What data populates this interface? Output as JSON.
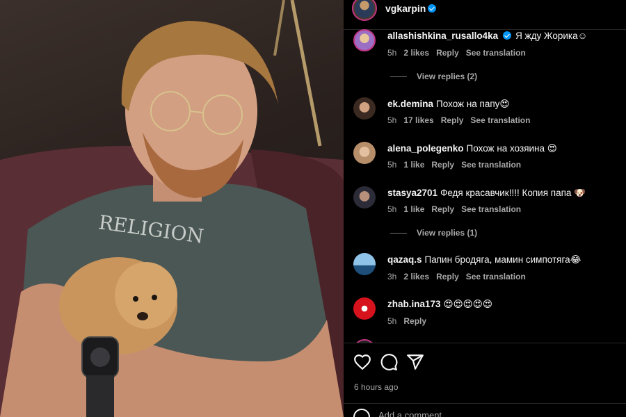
{
  "post": {
    "author": "vgkarpin",
    "time_ago": "6 hours ago",
    "add_comment_placeholder": "Add a comment..."
  },
  "comments": [
    {
      "username": "allashishkina_rusallo4ka",
      "verified": true,
      "text": "Я жду Жорика☺",
      "time": "5h",
      "likes": "2 likes",
      "reply": "Reply",
      "translate": "See translation",
      "view_replies": "View replies (2)"
    },
    {
      "username": "ek.demina",
      "text": "Похож на папу😍",
      "time": "5h",
      "likes": "17 likes",
      "reply": "Reply",
      "translate": "See translation"
    },
    {
      "username": "alena_polegenko",
      "text": "Похож на хозяина 😍",
      "time": "5h",
      "likes": "1 like",
      "reply": "Reply",
      "translate": "See translation"
    },
    {
      "username": "stasya2701",
      "text": "Федя красавчик!!!! Копия папа 🐶",
      "time": "5h",
      "likes": "1 like",
      "reply": "Reply",
      "translate": "See translation",
      "view_replies": "View replies (1)"
    },
    {
      "username": "qazaq.s",
      "text": "Папин бродяга, мамин симпотяга😂",
      "time": "3h",
      "likes": "2 likes",
      "reply": "Reply",
      "translate": "See translation"
    },
    {
      "username": "zhab.ina173",
      "text": "😍😍😍😍😍",
      "time": "5h",
      "reply": "Reply"
    }
  ],
  "colors": {
    "verified": "#0095f6",
    "story_ring": "#c13584",
    "muted": "#a8a8a8"
  },
  "icons": [
    "heart-icon",
    "comment-icon",
    "share-icon",
    "emoji-icon"
  ]
}
